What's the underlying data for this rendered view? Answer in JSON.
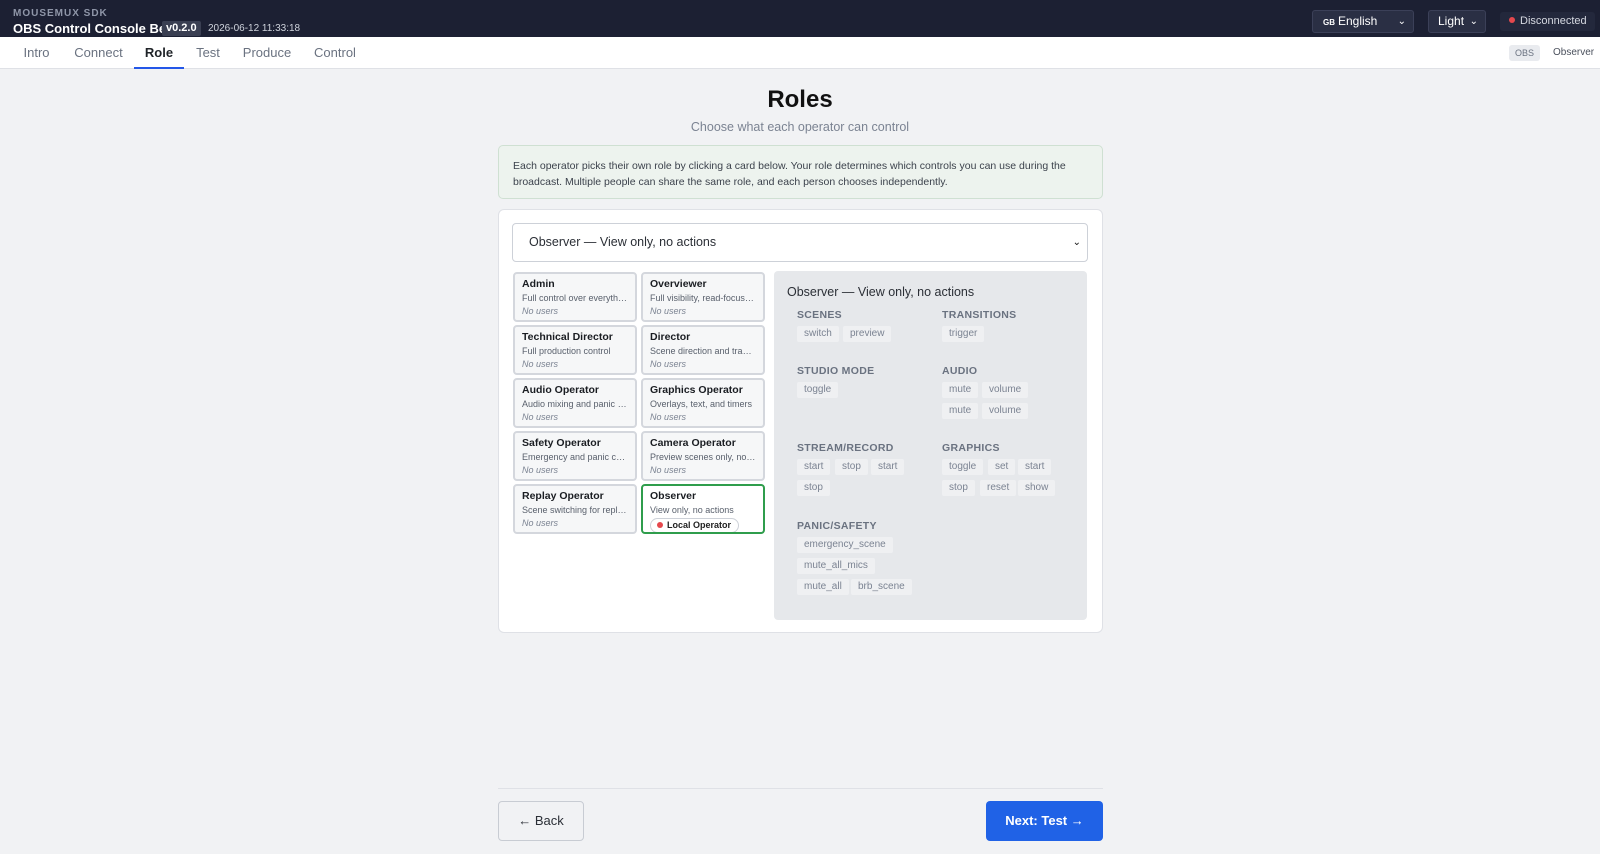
{
  "header": {
    "sdk": "MOUSEMUX SDK",
    "title": "OBS Control Console Beta",
    "version": "v0.2.0",
    "timestamp": "2026-06-12 11:33:18",
    "language": {
      "flag": "GB",
      "label": "English"
    },
    "theme": "Light",
    "connection_status": "Disconnected"
  },
  "tabs": [
    {
      "label": "Intro"
    },
    {
      "label": "Connect"
    },
    {
      "label": "Role",
      "active": true
    },
    {
      "label": "Test"
    },
    {
      "label": "Produce"
    },
    {
      "label": "Control"
    }
  ],
  "tabbar_right": {
    "obs_badge": "OBS",
    "current_role": "Observer"
  },
  "main": {
    "title": "Roles",
    "subtitle": "Choose what each operator can control",
    "info": "Each operator picks their own role by clicking a card below. Your role determines which controls you can use during the broadcast. Multiple people can share the same role, and each person chooses independently.",
    "role_select_value": "Observer — View only, no actions"
  },
  "roles": [
    {
      "name": "Admin",
      "desc": "Full control over everything",
      "users": "No users"
    },
    {
      "name": "Overviewer",
      "desc": "Full visibility, read-focused ...",
      "users": "No users"
    },
    {
      "name": "Technical Director",
      "desc": "Full production control",
      "users": "No users"
    },
    {
      "name": "Director",
      "desc": "Scene direction and transiti...",
      "users": "No users"
    },
    {
      "name": "Audio Operator",
      "desc": "Audio mixing and panic co...",
      "users": "No users"
    },
    {
      "name": "Graphics Operator",
      "desc": "Overlays, text, and timers",
      "users": "No users"
    },
    {
      "name": "Safety Operator",
      "desc": "Emergency and panic contr...",
      "users": "No users"
    },
    {
      "name": "Camera Operator",
      "desc": "Preview scenes only, no pr...",
      "users": "No users"
    },
    {
      "name": "Replay Operator",
      "desc": "Scene switching for replays...",
      "users": "No users"
    },
    {
      "name": "Observer",
      "desc": "View only, no actions",
      "operator": "Local Operator",
      "selected": true
    }
  ],
  "permissions": {
    "title": "Observer — View only, no actions",
    "groups": {
      "scenes": {
        "label": "SCENES",
        "chips": [
          "switch",
          "preview"
        ]
      },
      "transitions": {
        "label": "TRANSITIONS",
        "chips": [
          "trigger"
        ]
      },
      "studio_mode": {
        "label": "STUDIO MODE",
        "chips": [
          "toggle"
        ]
      },
      "audio": {
        "label": "AUDIO",
        "chips": [
          "mute",
          "volume",
          "mute",
          "volume"
        ]
      },
      "stream_record": {
        "label": "STREAM/RECORD",
        "chips": [
          "start",
          "stop",
          "start",
          "stop"
        ]
      },
      "graphics": {
        "label": "GRAPHICS",
        "chips": [
          "toggle",
          "set",
          "start",
          "stop",
          "reset",
          "show"
        ]
      },
      "panic_safety": {
        "label": "PANIC/SAFETY",
        "chips": [
          "emergency_scene",
          "mute_all_mics",
          "mute_all",
          "brb_scene"
        ]
      }
    }
  },
  "footer": {
    "back_label": "← Back",
    "next_label": "Next: Test →"
  },
  "colors": {
    "topbar": "#1c2033",
    "accent": "#2062e6",
    "selected_border": "#2f9d4c",
    "status_dot": "#e5484d"
  }
}
